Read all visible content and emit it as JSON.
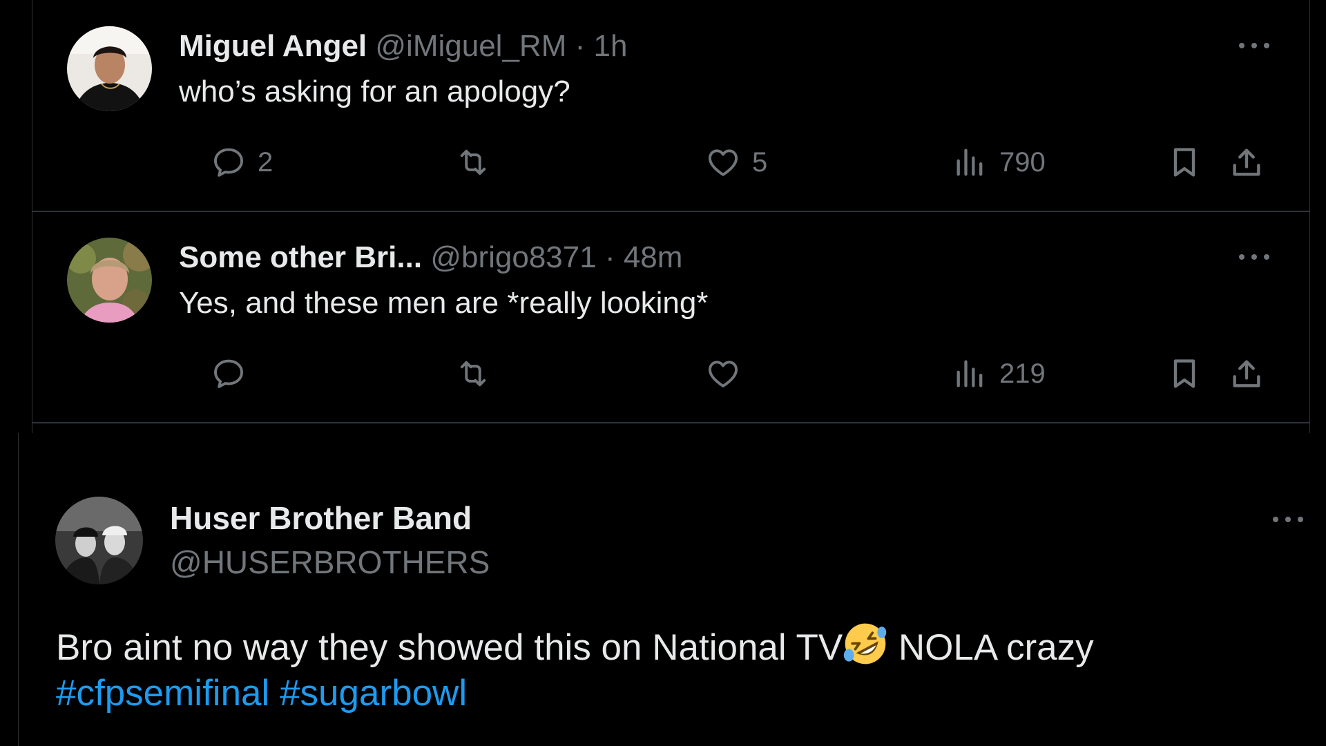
{
  "replies": [
    {
      "name": "Miguel Angel",
      "handle": "@iMiguel_RM",
      "separator": "·",
      "time": "1h",
      "text": "who’s asking for an apology?",
      "reply_count": "2",
      "retweet_count": "",
      "like_count": "5",
      "view_count": "790"
    },
    {
      "name": "Some other Bri...",
      "handle": "@brigo8371",
      "separator": "·",
      "time": "48m",
      "text": "Yes, and these men are *really looking*",
      "reply_count": "",
      "retweet_count": "",
      "like_count": "",
      "view_count": "219"
    }
  ],
  "post": {
    "name": "Huser Brother Band",
    "handle": "@HUSERBROTHERS",
    "text_before_emoji": "Bro aint no way they showed this on National TV",
    "text_after_emoji": " NOLA crazy",
    "hashtags": [
      "#cfpsemifinal",
      "#sugarbowl"
    ]
  },
  "colors": {
    "background": "#000000",
    "text": "#e7e9ea",
    "secondary": "#71767b",
    "divider": "#2f3336",
    "link": "#1d9bf0"
  },
  "icons": {
    "reply": "speech-bubble-icon",
    "retweet": "retweet-icon",
    "like": "heart-icon",
    "views": "bar-chart-icon",
    "bookmark": "bookmark-icon",
    "share": "share-icon",
    "more": "ellipsis-icon",
    "emoji": "rolling-on-floor-laughing-emoji"
  }
}
